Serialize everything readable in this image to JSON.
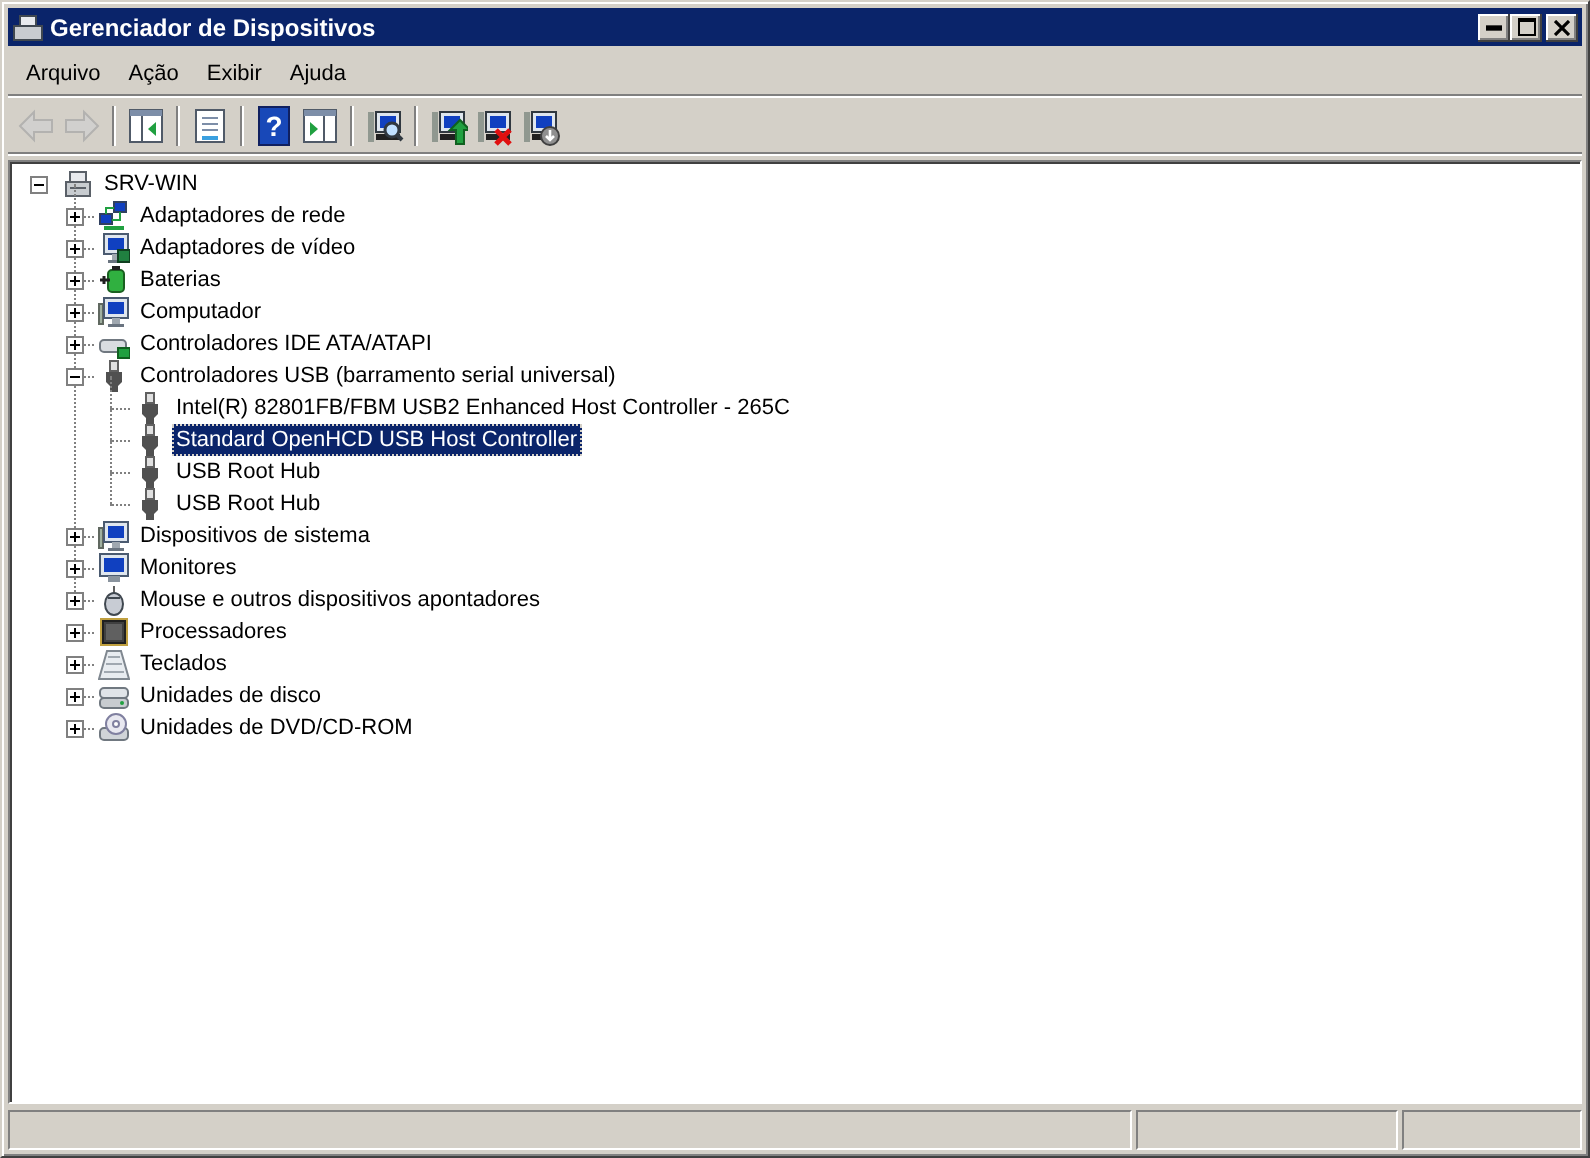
{
  "window": {
    "title": "Gerenciador de Dispositivos"
  },
  "menu": [
    {
      "label": "Arquivo"
    },
    {
      "label": "Ação"
    },
    {
      "label": "Exibir"
    },
    {
      "label": "Ajuda"
    }
  ],
  "toolbar": [
    {
      "kind": "back",
      "disabled": true
    },
    {
      "kind": "forward",
      "disabled": true
    },
    {
      "kind": "separator"
    },
    {
      "kind": "console-tree",
      "disabled": false
    },
    {
      "kind": "separator"
    },
    {
      "kind": "properties",
      "disabled": false
    },
    {
      "kind": "separator"
    },
    {
      "kind": "help",
      "disabled": false,
      "glyph": "?"
    },
    {
      "kind": "action-pane",
      "disabled": false
    },
    {
      "kind": "separator"
    },
    {
      "kind": "scan",
      "disabled": false
    },
    {
      "kind": "separator"
    },
    {
      "kind": "update",
      "disabled": false
    },
    {
      "kind": "uninstall",
      "disabled": false
    },
    {
      "kind": "disable",
      "disabled": false
    }
  ],
  "tree": {
    "label": "SRV-WIN",
    "kind": "server",
    "expanded": true,
    "selected": false,
    "children": [
      {
        "label": "Adaptadores de rede",
        "kind": "network",
        "expanded": false,
        "selected": false
      },
      {
        "label": "Adaptadores de vídeo",
        "kind": "display",
        "expanded": false,
        "selected": false
      },
      {
        "label": "Baterias",
        "kind": "battery",
        "expanded": false,
        "selected": false
      },
      {
        "label": "Computador",
        "kind": "computer",
        "expanded": false,
        "selected": false
      },
      {
        "label": "Controladores IDE ATA/ATAPI",
        "kind": "ide",
        "expanded": false,
        "selected": false
      },
      {
        "label": "Controladores USB (barramento serial universal)",
        "kind": "usb",
        "expanded": true,
        "selected": false,
        "children": [
          {
            "label": "Intel(R) 82801FB/FBM USB2 Enhanced Host Controller - 265C",
            "kind": "usb",
            "selected": false
          },
          {
            "label": "Standard OpenHCD USB Host Controller",
            "kind": "usb",
            "selected": true
          },
          {
            "label": "USB Root Hub",
            "kind": "usb",
            "selected": false
          },
          {
            "label": "USB Root Hub",
            "kind": "usb",
            "selected": false
          }
        ]
      },
      {
        "label": "Dispositivos de sistema",
        "kind": "computer",
        "expanded": false,
        "selected": false
      },
      {
        "label": "Monitores",
        "kind": "monitor",
        "expanded": false,
        "selected": false
      },
      {
        "label": "Mouse e outros dispositivos apontadores",
        "kind": "mouse",
        "expanded": false,
        "selected": false
      },
      {
        "label": "Processadores",
        "kind": "processor",
        "expanded": false,
        "selected": false
      },
      {
        "label": "Teclados",
        "kind": "keyboard",
        "expanded": false,
        "selected": false
      },
      {
        "label": "Unidades de disco",
        "kind": "disk",
        "expanded": false,
        "selected": false
      },
      {
        "label": "Unidades de DVD/CD-ROM",
        "kind": "dvd",
        "expanded": false,
        "selected": false
      }
    ]
  }
}
